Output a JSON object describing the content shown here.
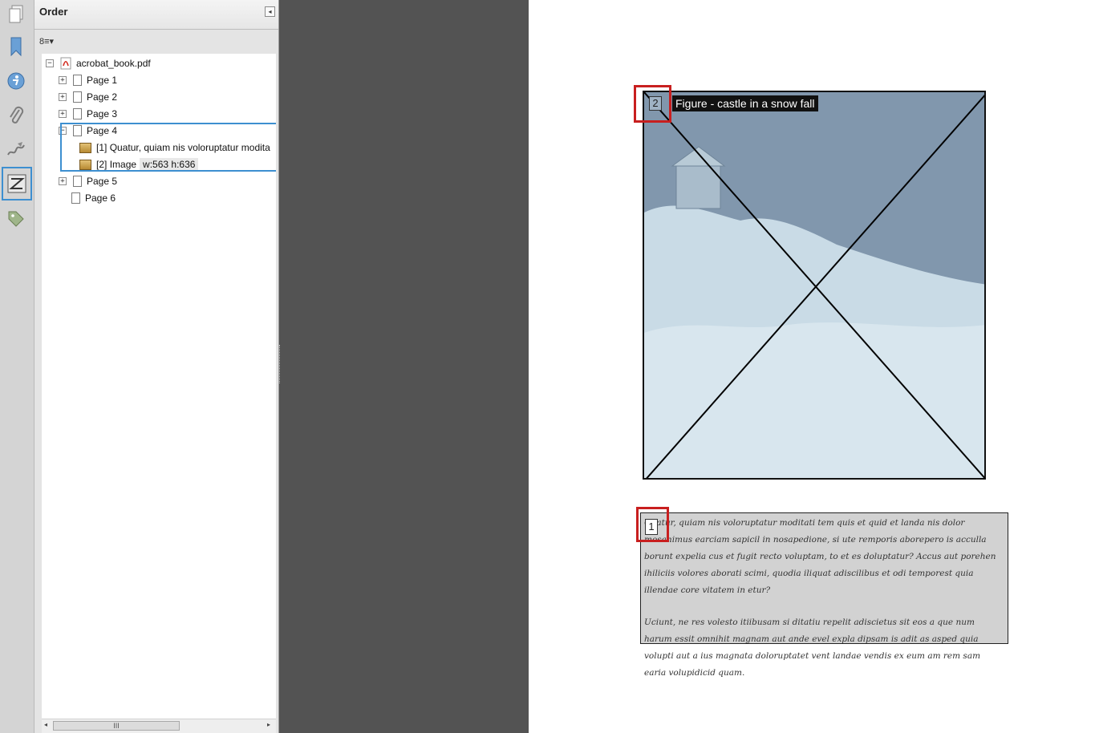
{
  "rail": {
    "icons": [
      "pages-icon",
      "bookmarks-icon",
      "accessibility-icon",
      "attachments-icon",
      "signatures-icon",
      "order-icon",
      "tags-icon"
    ]
  },
  "panel": {
    "title": "Order",
    "collapse_glyph": "◂",
    "options_glyph": "8≡▾"
  },
  "tree": {
    "root": "acrobat_book.pdf",
    "pages": [
      {
        "label": "Page 1",
        "toggle": "+"
      },
      {
        "label": "Page 2",
        "toggle": "+"
      },
      {
        "label": "Page 3",
        "toggle": "+"
      },
      {
        "label": "Page 4",
        "toggle": "−"
      },
      {
        "label": "Page 5",
        "toggle": "+"
      },
      {
        "label": "Page 6",
        "toggle": ""
      }
    ],
    "page4_children": [
      {
        "index": "[1]",
        "label": "Quatur, quiam nis voloruptatur modita"
      },
      {
        "index": "[2]",
        "label": "Image",
        "size": "w:563 h:636"
      }
    ],
    "root_toggle": "−"
  },
  "scrollbar": {
    "left": "◂",
    "right": "▸",
    "grip": "III"
  },
  "document": {
    "figure_tooltip": "Figure - castle in a snow fall",
    "figure_order": "2",
    "text_order": "1",
    "text_paragraphs": [
      "Quatur, quiam nis voloruptatur moditati tem quis et quid et landa nis dolor mosanimus earciam sapicil in nosapedione, si ute remporis aborepero is acculla borunt expelia cus et fugit recto voluptam, to et es doluptatur? Accus aut porehen ihiliciis volores aborati scimi, quodia iliquat adiscilibus et odi temporest quia illendae core vitatem in etur?",
      "Uciunt, ne res volesto itiibusam si ditatiu repelit adiscietus sit eos a que num harum essit omnihit magnam aut ande evel expla dipsam is adit as asped quia volupti aut a ius magnata doloruptatet vent landae vendis ex eum am rem sam earia volupidicid quam."
    ]
  },
  "colors": {
    "accent_selection": "#3d8fd0",
    "order_box": "#c81f1f",
    "figure_bg": "#8197ad",
    "gap_bg": "#535353"
  }
}
